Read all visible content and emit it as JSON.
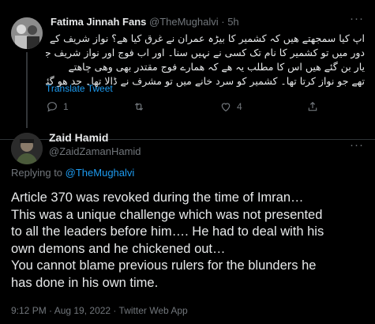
{
  "reply_tweet": {
    "author_name": "Fatima Jinnah Fans",
    "author_handle": "@TheMughalvi",
    "time": "5h",
    "separator": " · ",
    "text_lines": [
      "اپ کیا سمجھتے ھیں کہ کشمیر کا بیڑہ عمران نے غرق کیا ھے؟ نواز شریف کے",
      "دور میں تو کشمیر کا نام تک کسی نے نہیں سنا۔ اور اب فوج اور نواز شریف جگری",
      "یار بن گئے ھیں اس کا مطلب یہ ھے کہ ھمارے فوج مقتدر بھی وھی چاھتے",
      "تھے جو نواز کرتا تھا۔ کشمیر کو سرد خانے میں تو مشرف نے ڈالا تھا۔ حد ھو گئی"
    ],
    "translate_label": "Translate Tweet",
    "reply_count": "1",
    "retweet_count": "",
    "like_count": "4"
  },
  "main_tweet": {
    "author_name": "Zaid Hamid",
    "author_handle": "@ZaidZamanHamid",
    "replying_prefix": "Replying to ",
    "replying_mention": "@TheMughalvi",
    "text_lines": [
      "Article 370 was revoked during the time of Imran…",
      "This was a unique challenge which was not presented",
      "to all the leaders before him…. He had to deal with his",
      "own demons and he chickened out…",
      "You cannot blame previous rulers for the blunders he",
      "has done in his own time."
    ],
    "meta": "9:12 PM · Aug 19, 2022 · Twitter Web App"
  },
  "icons": {
    "more": "more-icon",
    "reply": "reply-icon",
    "retweet": "retweet-icon",
    "like": "heart-icon",
    "share": "share-icon"
  },
  "colors": {
    "background": "#000000",
    "text": "#e7e9ea",
    "secondary": "#71767b",
    "link": "#1d9bf0"
  }
}
